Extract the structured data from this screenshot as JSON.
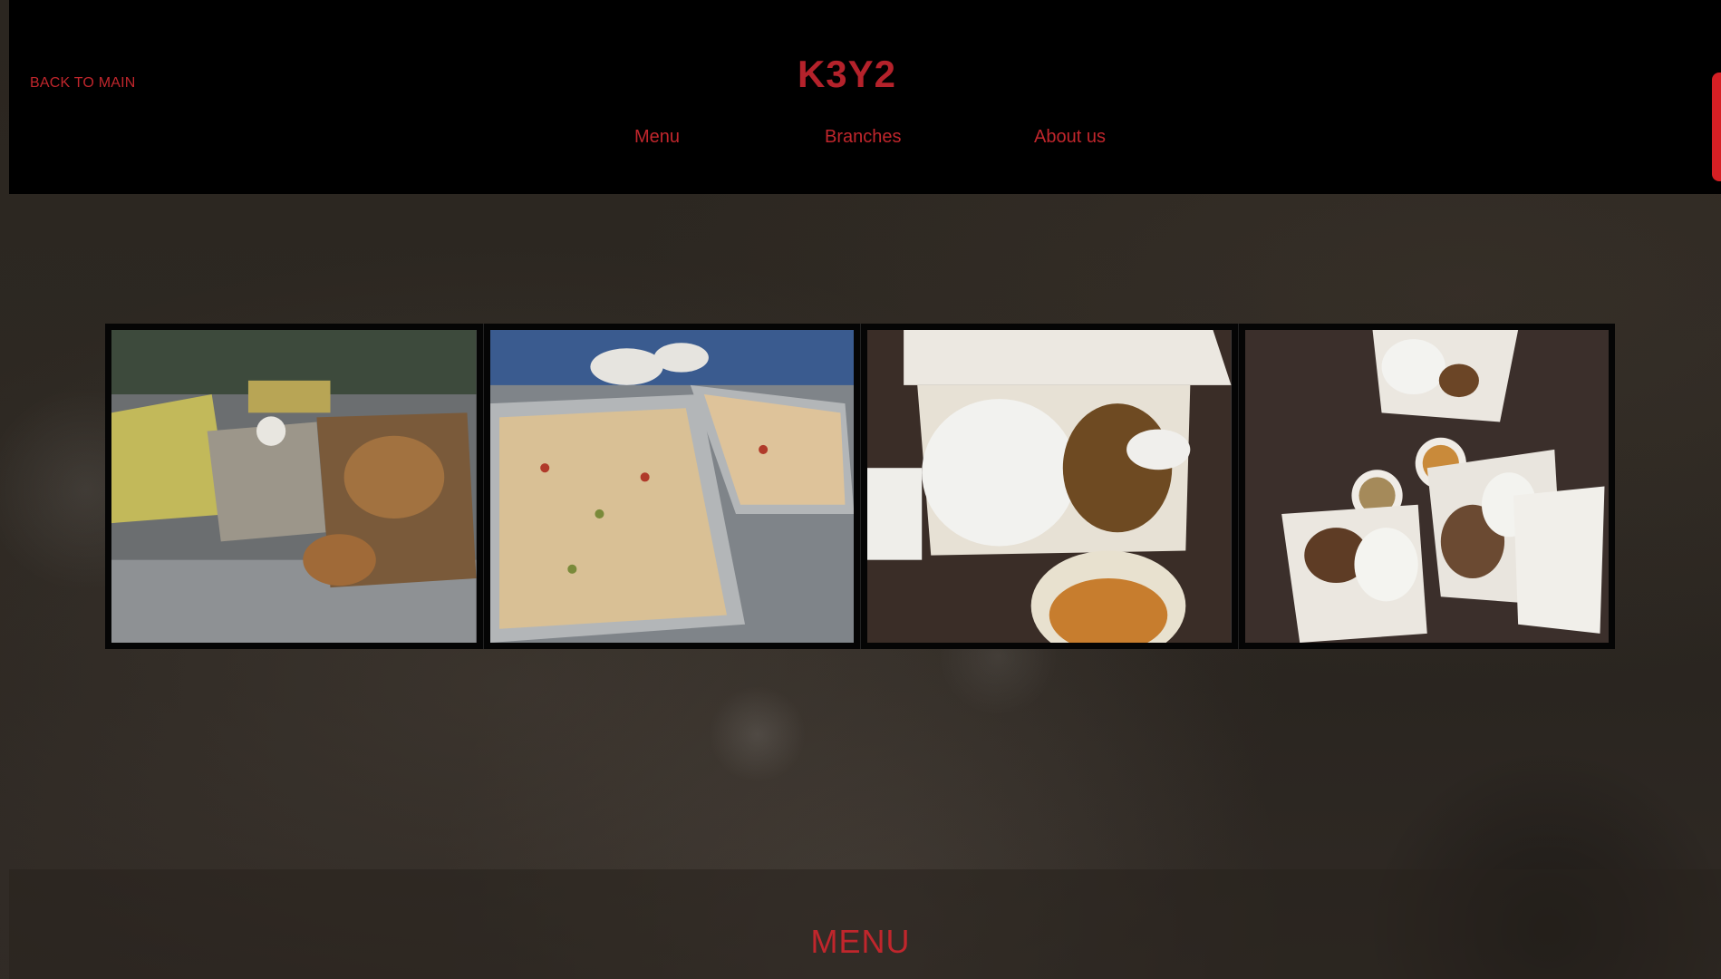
{
  "header": {
    "back_link": "BACK TO MAIN",
    "brand": "K3Y2",
    "nav": [
      {
        "label": "Menu"
      },
      {
        "label": "Branches"
      },
      {
        "label": "About us"
      }
    ]
  },
  "gallery": {
    "photos": [
      {
        "icon": "food-tray-photo"
      },
      {
        "icon": "baked-dish-photo"
      },
      {
        "icon": "rice-box-photo"
      },
      {
        "icon": "meal-spread-photo"
      }
    ]
  },
  "footer": {
    "heading": "MENU"
  },
  "colors": {
    "accent": "#c0262c",
    "header_bg": "#000000",
    "page_bg": "#2b2620"
  }
}
